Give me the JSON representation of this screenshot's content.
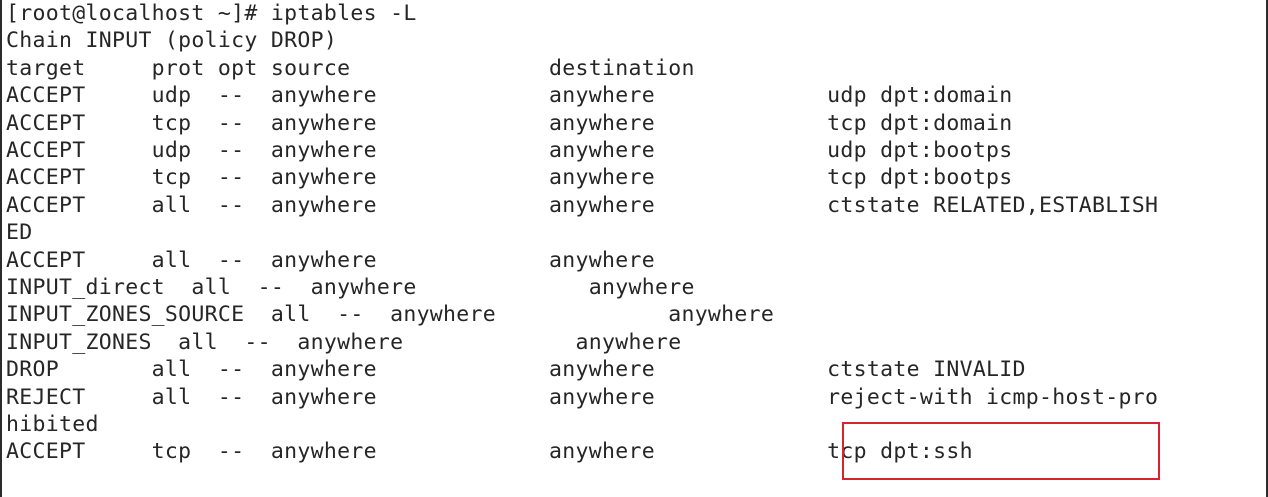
{
  "terminal": {
    "lines": [
      "[root@localhost ~]# iptables -L",
      "Chain INPUT (policy DROP)",
      "target     prot opt source               destination",
      "ACCEPT     udp  --  anywhere             anywhere             udp dpt:domain",
      "ACCEPT     tcp  --  anywhere             anywhere             tcp dpt:domain",
      "ACCEPT     udp  --  anywhere             anywhere             udp dpt:bootps",
      "ACCEPT     tcp  --  anywhere             anywhere             tcp dpt:bootps",
      "ACCEPT     all  --  anywhere             anywhere             ctstate RELATED,ESTABLISH",
      "ED",
      "ACCEPT     all  --  anywhere             anywhere",
      "INPUT_direct  all  --  anywhere             anywhere",
      "INPUT_ZONES_SOURCE  all  --  anywhere             anywhere",
      "INPUT_ZONES  all  --  anywhere             anywhere",
      "DROP       all  --  anywhere             anywhere             ctstate INVALID",
      "REJECT     all  --  anywhere             anywhere             reject-with icmp-host-pro",
      "hibited",
      "ACCEPT     tcp  --  anywhere             anywhere             tcp dpt:ssh"
    ],
    "highlight_color": "#d9232b"
  }
}
